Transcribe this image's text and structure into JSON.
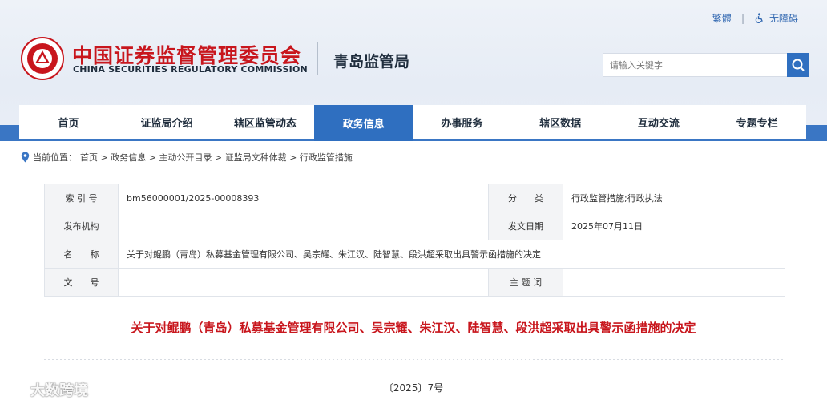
{
  "header": {
    "toplinks": {
      "traditional": "繁體",
      "accessibility": "无障碍"
    },
    "title_cn": "中国证券监督管理委员会",
    "title_en": "CHINA SECURITIES REGULATORY COMMISSION",
    "bureau": "青岛监管局",
    "search": {
      "placeholder": "请输入关键字"
    }
  },
  "nav": {
    "items": [
      {
        "label": "首页"
      },
      {
        "label": "证监局介绍"
      },
      {
        "label": "辖区监管动态"
      },
      {
        "label": "政务信息",
        "active": true
      },
      {
        "label": "办事服务"
      },
      {
        "label": "辖区数据"
      },
      {
        "label": "互动交流"
      },
      {
        "label": "专题专栏"
      }
    ]
  },
  "breadcrumb": {
    "prefix": "当前位置：",
    "path": "首页 > 政务信息 > 主动公开目录 > 证监局文种体裁 > 行政监管措施"
  },
  "info": {
    "index_label": "索 引 号",
    "index_value": "bm56000001/2025-00008393",
    "category_label": "分　　类",
    "category_value": "行政监管措施;行政执法",
    "publisher_label": "发布机构",
    "publisher_value": "",
    "date_label": "发文日期",
    "date_value": "2025年07月11日",
    "name_label": "名　　称",
    "name_value": "关于对鲲鹏（青岛）私募基金管理有限公司、吴宗耀、朱江汉、陆智慧、段洪超采取出具警示函措施的决定",
    "docno_label": "文　　号",
    "docno_value": "",
    "keywords_label": "主 题 词",
    "keywords_value": ""
  },
  "document": {
    "title": "关于对鲲鹏（青岛）私募基金管理有限公司、吴宗耀、朱江汉、陆智慧、段洪超采取出具警示函措施的决定",
    "number": "〔2025〕7号"
  },
  "watermark": {
    "text": "大数跨境"
  },
  "colors": {
    "brand_red": "#c8161d",
    "nav_blue": "#2f6fc0"
  }
}
